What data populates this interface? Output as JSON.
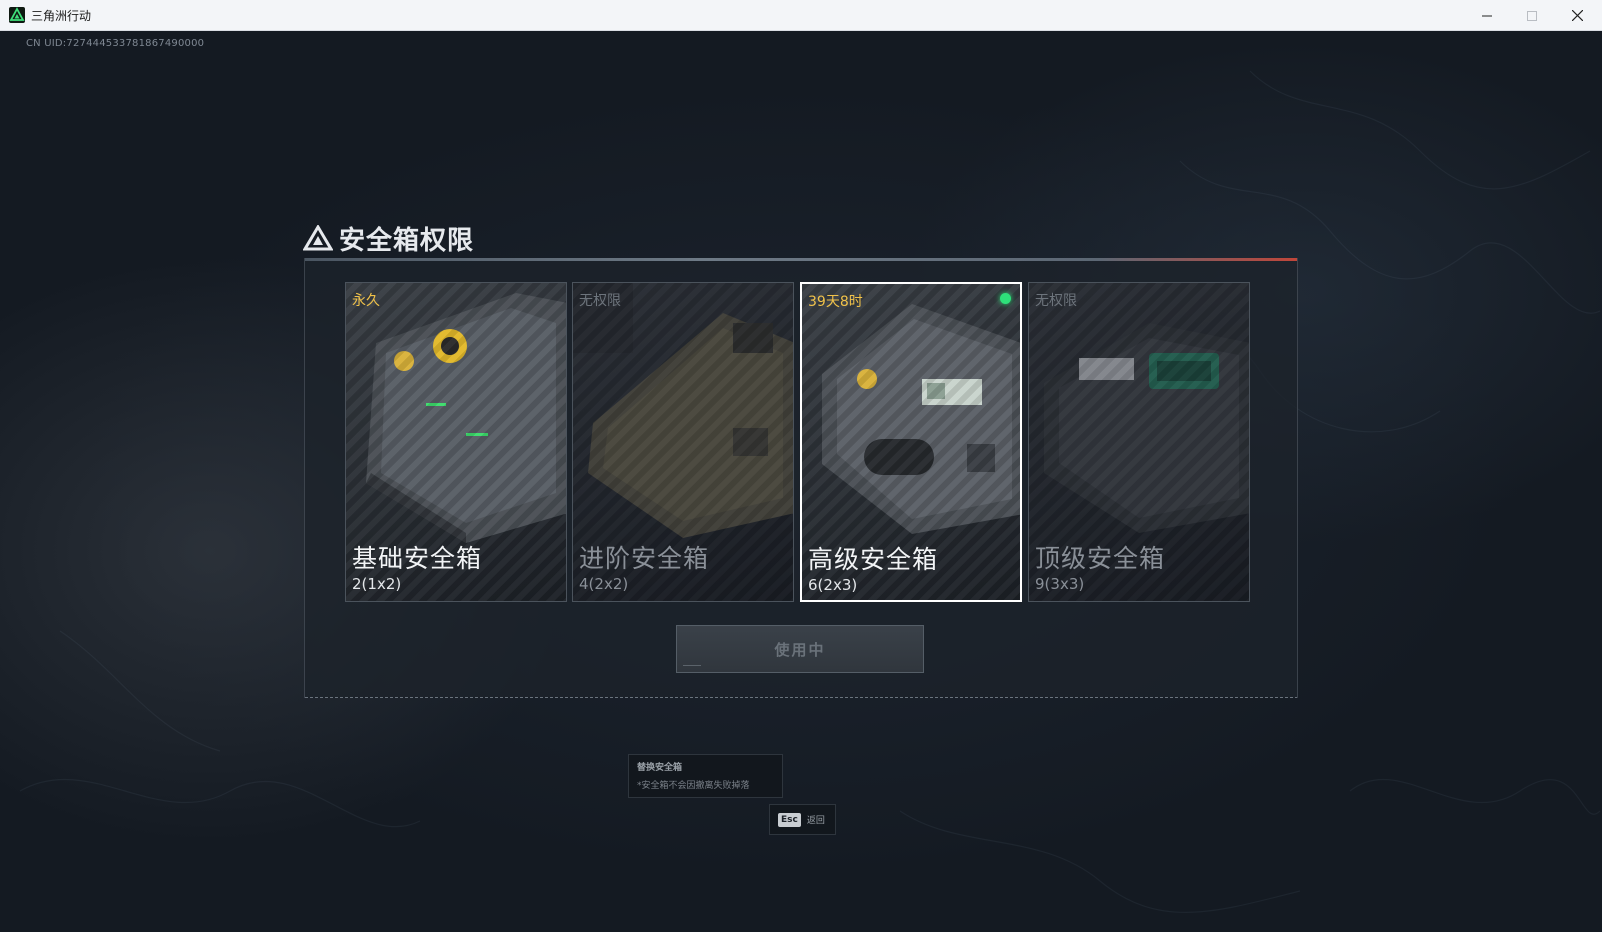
{
  "window": {
    "title": "三角洲行动",
    "minimize_icon": "minimize-icon",
    "maximize_icon": "maximize-icon",
    "close_icon": "close-icon"
  },
  "uid_text": "CN UID:727444533781867490000",
  "panel": {
    "title": "安全箱权限",
    "cards": [
      {
        "tag": "永久",
        "name": "基础安全箱",
        "size": "2(1x2)",
        "locked": false,
        "selected": false
      },
      {
        "tag": "无权限",
        "name": "进阶安全箱",
        "size": "4(2x2)",
        "locked": true,
        "selected": false
      },
      {
        "tag": "39天8时",
        "name": "高级安全箱",
        "size": "6(2x3)",
        "locked": false,
        "selected": true,
        "active": true
      },
      {
        "tag": "无权限",
        "name": "顶级安全箱",
        "size": "9(3x3)",
        "locked": true,
        "selected": false
      }
    ],
    "action_button": "使用中"
  },
  "info": {
    "heading": "替换安全箱",
    "description": "*安全箱不会因撤离失败掉落"
  },
  "esc": {
    "key": "Esc",
    "label": "返回"
  },
  "colors": {
    "accent_gold": "#f0c24a",
    "active_green": "#2ee07a",
    "background": "#141a22"
  }
}
